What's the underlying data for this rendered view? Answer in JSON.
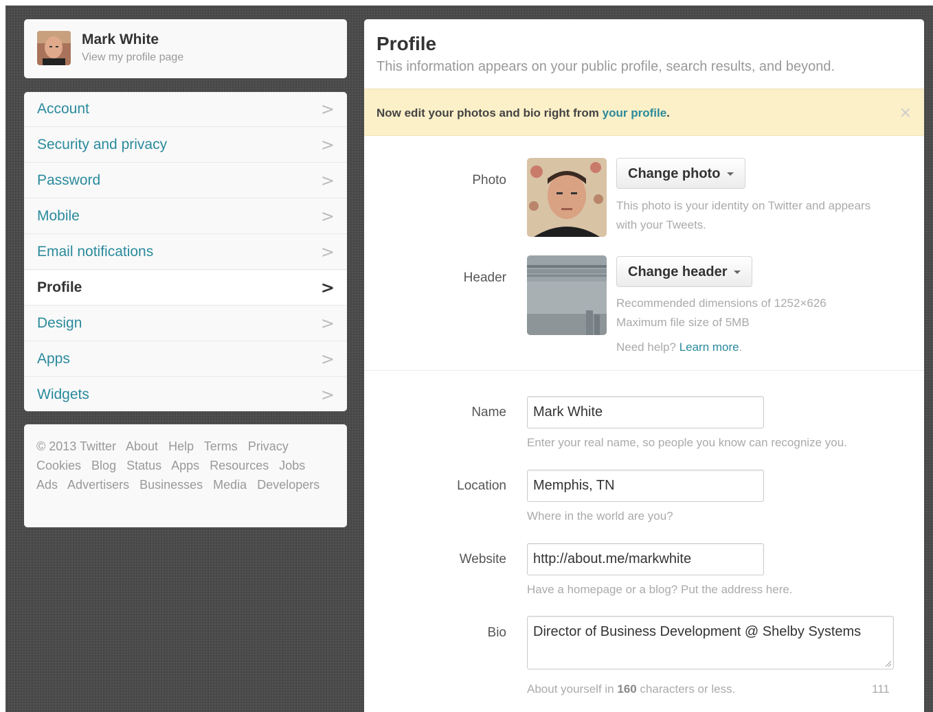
{
  "user": {
    "name": "Mark White",
    "profile_link": "View my profile page"
  },
  "nav": {
    "items": [
      {
        "label": "Account",
        "active": false
      },
      {
        "label": "Security and privacy",
        "active": false
      },
      {
        "label": "Password",
        "active": false
      },
      {
        "label": "Mobile",
        "active": false
      },
      {
        "label": "Email notifications",
        "active": false
      },
      {
        "label": "Profile",
        "active": true
      },
      {
        "label": "Design",
        "active": false
      },
      {
        "label": "Apps",
        "active": false
      },
      {
        "label": "Widgets",
        "active": false
      }
    ],
    "chevron": ">"
  },
  "footer": {
    "links": [
      "© 2013 Twitter",
      "About",
      "Help",
      "Terms",
      "Privacy",
      "Cookies",
      "Blog",
      "Status",
      "Apps",
      "Resources",
      "Jobs",
      "Ads",
      "Advertisers",
      "Businesses",
      "Media",
      "Developers"
    ]
  },
  "main": {
    "title": "Profile",
    "subtitle": "This information appears on your public profile, search results, and beyond.",
    "notice": {
      "text": "Now edit your photos and bio right from ",
      "link": "your profile",
      "end": ".",
      "close": "×"
    },
    "photo": {
      "label": "Photo",
      "button": "Change photo",
      "help_line1": "This photo is your identity on Twitter and appears",
      "help_line2": "with your Tweets."
    },
    "header": {
      "label": "Header",
      "button": "Change header",
      "help_line1": "Recommended dimensions of 1252×626",
      "help_line2": "Maximum file size of 5MB",
      "need_help": "Need help? ",
      "learn_more": "Learn more",
      "learn_more_end": "."
    },
    "name": {
      "label": "Name",
      "value": "Mark White",
      "help": "Enter your real name, so people you know can recognize you."
    },
    "location": {
      "label": "Location",
      "value": "Memphis, TN",
      "help": "Where in the world are you?"
    },
    "website": {
      "label": "Website",
      "value": "http://about.me/markwhite",
      "help": "Have a homepage or a blog? Put the address here."
    },
    "bio": {
      "label": "Bio",
      "value": "Director of Business Development @ Shelby Systems",
      "help_pre": "About yourself in ",
      "help_bold": "160",
      "help_post": " characters or less.",
      "remaining": "111"
    }
  },
  "colors": {
    "link": "#2a8a9c",
    "notice_bg": "#fcf0c8",
    "page_bg": "#484848"
  }
}
